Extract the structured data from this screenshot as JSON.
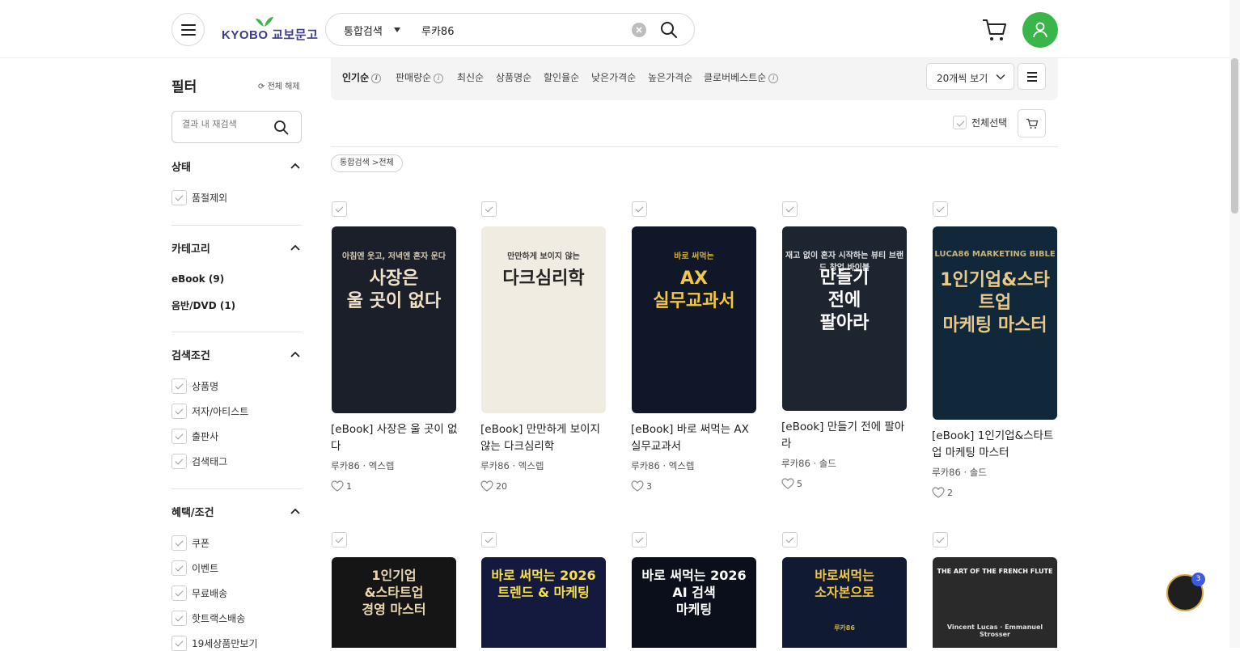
{
  "header": {
    "logo_text": "KYOBO 교보문고",
    "search_scope": "통합검색",
    "search_value": "루카86"
  },
  "sidebar": {
    "title": "필터",
    "reset_label": "전체 해제",
    "sub_search_placeholder": "결과 내 재검색",
    "status": {
      "title": "상태",
      "items": [
        "품절제외"
      ]
    },
    "category": {
      "title": "카테고리",
      "items": [
        "eBook (9)",
        "음반/DVD (1)"
      ]
    },
    "search_cond": {
      "title": "검색조건",
      "items": [
        "상품명",
        "저자/아티스트",
        "출판사",
        "검색태그"
      ]
    },
    "benefits": {
      "title": "혜택/조건",
      "items": [
        "쿠폰",
        "이벤트",
        "무료배송",
        "핫트랙스배송",
        "19세상품만보기"
      ]
    }
  },
  "sort": {
    "options": [
      "인기순",
      "판매량순",
      "최신순",
      "상품명순",
      "할인율순",
      "낮은가격순",
      "높은가격순",
      "클로버베스트순"
    ],
    "per_page": "20개씩 보기"
  },
  "select_all_label": "전체선택",
  "breadcrumb": "통합검색 >전체",
  "products": [
    {
      "title": "[eBook] 사장은 울 곳이 없다",
      "meta": "루카86 · 엑스렙",
      "likes": "1",
      "cover": {
        "bg": "#1b1f2a",
        "main": "사장은\n울 곳이 없다",
        "sub": "아침엔 웃고, 저녁엔 혼자 운다"
      }
    },
    {
      "title": "[eBook] 만만하게 보이지 않는 다크심리학",
      "meta": "루카86 · 엑스렙",
      "likes": "20",
      "cover": {
        "bg": "#f1ece1",
        "main": "다크심리학",
        "sub": "만만하게 보이지 않는"
      }
    },
    {
      "title": "[eBook] 바로 써먹는 AX 실무교과서",
      "meta": "루카86 · 엑스렙",
      "likes": "3",
      "cover": {
        "bg": "#0f1729",
        "main": "AX\n실무교과서",
        "sub": "바로 써먹는"
      }
    },
    {
      "title": "[eBook] 만들기 전에 팔아라",
      "meta": "루카86 · 솔드",
      "likes": "5",
      "cover": {
        "bg": "#1d2531",
        "main": "만들기\n전에\n팔아라",
        "sub": "재고 없이 혼자 시작하는 뷰티 브랜드 창업 바이블"
      }
    },
    {
      "title": "[eBook] 1인기업&스타트업 마케팅 마스터",
      "meta": "루카86 · 솔드",
      "likes": "2",
      "cover": {
        "bg": "#10283a",
        "main": "1인기업&스타트업\n마케팅 마스터",
        "sub": "LUCA86 MARKETING BIBLE"
      }
    }
  ],
  "products_row2": [
    {
      "cover": {
        "bg": "#151515",
        "main": "1인기업\n&스타트업\n경영 마스터",
        "sub": ""
      }
    },
    {
      "cover": {
        "bg": "#141a3d",
        "main": "바로 써먹는 2026\n트렌드 & 마케팅",
        "sub": ""
      }
    },
    {
      "cover": {
        "bg": "#0b0f1c",
        "main": "바로 써먹는 2026\nAI 검색\n마케팅",
        "sub": ""
      }
    },
    {
      "cover": {
        "bg": "#101a33",
        "main": "바로써먹는\n소자본으로",
        "sub": "루카86"
      }
    },
    {
      "cover": {
        "bg": "#2a2a2a",
        "main": "THE ART OF THE FRENCH FLUTE",
        "sub": "Vincent Lucas · Emmanuel Strosser"
      }
    }
  ],
  "floating_badge_count": "3",
  "colors": {
    "brand_green": "#3ab54a",
    "accent_blue": "#3b5bdb"
  }
}
